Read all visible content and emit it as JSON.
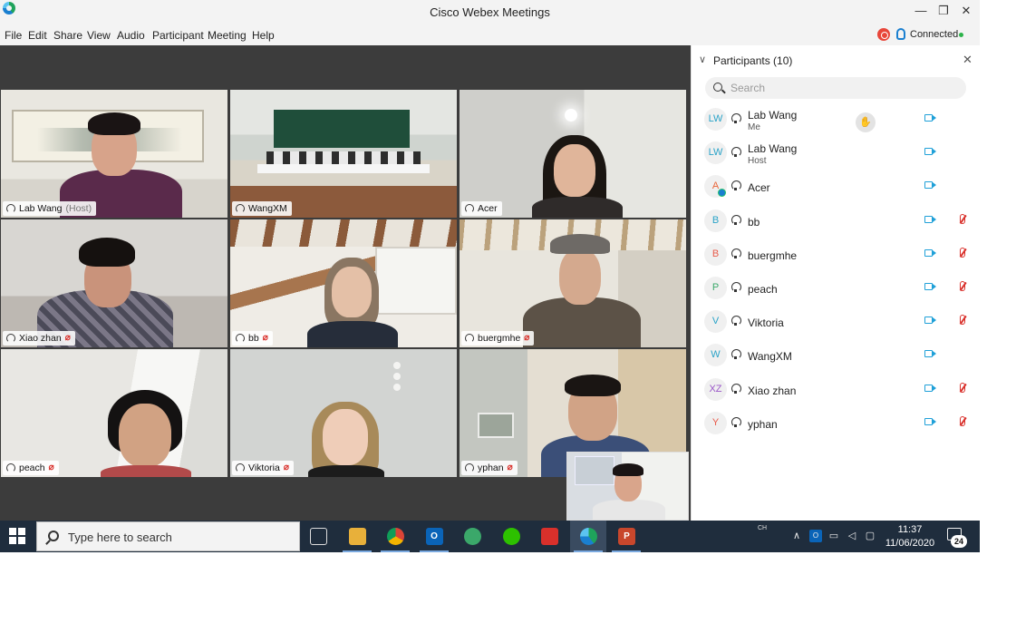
{
  "window": {
    "title": "Cisco Webex Meetings",
    "minimize": "—",
    "restore": "❐",
    "close": "✕"
  },
  "menu": [
    "File",
    "Edit",
    "Share",
    "View",
    "Audio",
    "Participant",
    "Meeting",
    "Help"
  ],
  "status": {
    "connection": "Connected"
  },
  "tiles": [
    {
      "name": "Lab Wang",
      "role": "(Host)",
      "muted": false,
      "active": true
    },
    {
      "name": "WangXM",
      "role": "",
      "muted": false,
      "active": false
    },
    {
      "name": "Acer",
      "role": "",
      "muted": false,
      "active": false
    },
    {
      "name": "Xiao zhan",
      "role": "",
      "muted": true,
      "active": false
    },
    {
      "name": "bb",
      "role": "",
      "muted": true,
      "active": false
    },
    {
      "name": "buergmhe",
      "role": "",
      "muted": true,
      "active": false
    },
    {
      "name": "peach",
      "role": "",
      "muted": true,
      "active": false
    },
    {
      "name": "Viktoria",
      "role": "",
      "muted": true,
      "active": false
    },
    {
      "name": "yphan",
      "role": "",
      "muted": true,
      "active": false
    }
  ],
  "panel": {
    "title": "Participants (10)",
    "close": "✕",
    "search_placeholder": "Search",
    "raise_hand": "✋",
    "participants": [
      {
        "initials": "LW",
        "initials_color": "#2aa3c8",
        "name": "Lab Wang",
        "role": "Me",
        "muted": false
      },
      {
        "initials": "LW",
        "initials_color": "#2aa3c8",
        "name": "Lab Wang",
        "role": "Host",
        "muted": false
      },
      {
        "initials": "A",
        "initials_color": "#e8663a",
        "name": "Acer",
        "role": "",
        "muted": false
      },
      {
        "initials": "B",
        "initials_color": "#2aa3c8",
        "name": "bb",
        "role": "",
        "muted": true
      },
      {
        "initials": "B",
        "initials_color": "#e85a4a",
        "name": "buergmhe",
        "role": "",
        "muted": true
      },
      {
        "initials": "P",
        "initials_color": "#3ba86a",
        "name": "peach",
        "role": "",
        "muted": true
      },
      {
        "initials": "V",
        "initials_color": "#2aa3c8",
        "name": "Viktoria",
        "role": "",
        "muted": true
      },
      {
        "initials": "W",
        "initials_color": "#2aa3c8",
        "name": "WangXM",
        "role": "",
        "muted": false
      },
      {
        "initials": "XZ",
        "initials_color": "#9a57c8",
        "name": "Xiao zhan",
        "role": "",
        "muted": true
      },
      {
        "initials": "Y",
        "initials_color": "#e85a4a",
        "name": "yphan",
        "role": "",
        "muted": true
      }
    ]
  },
  "taskbar": {
    "search_placeholder": "Type here to search",
    "apps": [
      {
        "name": "task-view",
        "label": "",
        "color": "#1f2d3d",
        "running": false,
        "focused": false
      },
      {
        "name": "file-explorer",
        "label": "",
        "color": "#e8b03a",
        "running": true,
        "focused": false
      },
      {
        "name": "chrome",
        "label": "",
        "color": "#db4437",
        "running": true,
        "focused": false
      },
      {
        "name": "outlook",
        "label": "O",
        "color": "#0a64b8",
        "running": true,
        "focused": false
      },
      {
        "name": "paint",
        "label": "",
        "color": "#3ba86a",
        "running": false,
        "focused": false
      },
      {
        "name": "wechat",
        "label": "",
        "color": "#2dc100",
        "running": false,
        "focused": false
      },
      {
        "name": "acrobat",
        "label": "",
        "color": "#d9302b",
        "running": false,
        "focused": false
      },
      {
        "name": "webex",
        "label": "",
        "color": "#1fa35b",
        "running": true,
        "focused": true
      },
      {
        "name": "powerpoint",
        "label": "P",
        "color": "#c8472c",
        "running": true,
        "focused": false
      }
    ],
    "lang": "CH",
    "time": "11:37",
    "date": "11/06/2020",
    "notifications": "24"
  }
}
